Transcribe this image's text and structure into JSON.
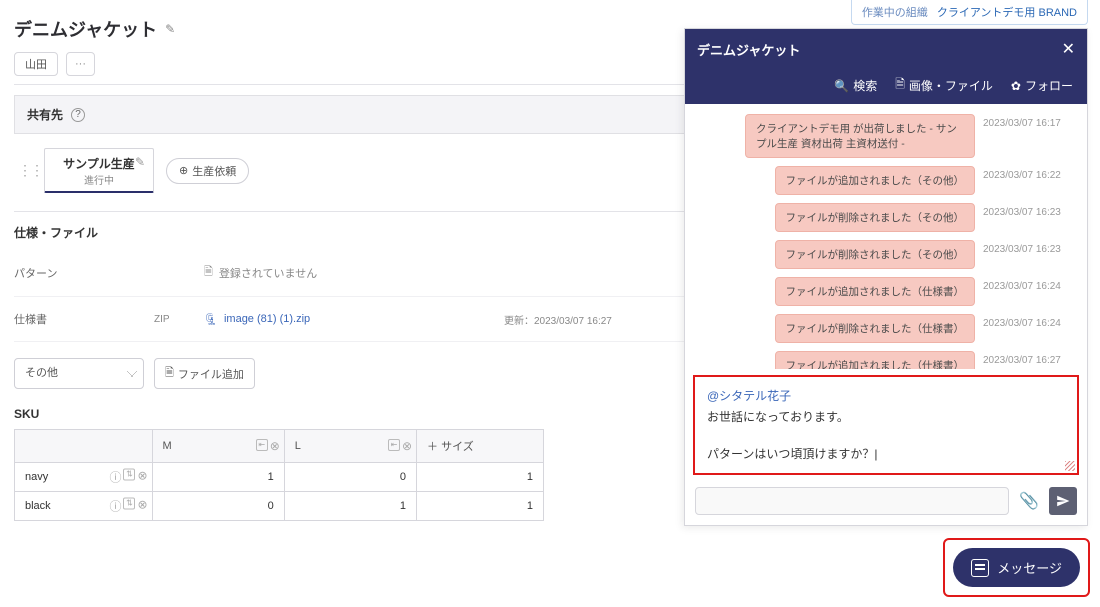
{
  "org_banner": {
    "label": "作業中の組織",
    "name": "クライアントデモ用 BRAND"
  },
  "page": {
    "title": "デニムジャケット",
    "chips": {
      "owner": "山田",
      "more": "···"
    },
    "share_label": "共有先",
    "tabs": {
      "sample": {
        "title": "サンプル生産",
        "sub": "進行中"
      },
      "production_btn": "生産依頼"
    },
    "spec_heading": "仕様・ファイル",
    "rows": {
      "pattern": {
        "label": "パターン",
        "placeholder": "登録されていません"
      },
      "spec": {
        "label": "仕様書",
        "ext": "ZIP",
        "filename": "image (81) (1).zip",
        "updated": "更新：2023/03/07 16:27"
      }
    },
    "controls": {
      "other_select": "その他",
      "file_add": "ファイル追加"
    },
    "sku_heading": "SKU",
    "sku": {
      "size_add": "＋ サイズ",
      "sizes": [
        "M",
        "L"
      ],
      "rows": [
        {
          "color": "navy",
          "values": [
            1,
            0,
            1
          ]
        },
        {
          "color": "black",
          "values": [
            0,
            1,
            1
          ]
        }
      ]
    }
  },
  "chat": {
    "title": "デニムジャケット",
    "actions": {
      "search": "検索",
      "images": "画像・ファイル",
      "follow": "フォロー"
    },
    "events": [
      {
        "text": "クライアントデモ用 が出荷しました\n- サンプル生産 資材出荷 主資材送付 -",
        "time": "2023/03/07 16:17"
      },
      {
        "text": "ファイルが追加されました（その他）",
        "time": "2023/03/07 16:22"
      },
      {
        "text": "ファイルが削除されました（その他）",
        "time": "2023/03/07 16:23"
      },
      {
        "text": "ファイルが削除されました（その他）",
        "time": "2023/03/07 16:23"
      },
      {
        "text": "ファイルが追加されました（仕様書）",
        "time": "2023/03/07 16:24"
      },
      {
        "text": "ファイルが削除されました（仕様書）",
        "time": "2023/03/07 16:24"
      },
      {
        "text": "ファイルが追加されました（仕様書）",
        "time": "2023/03/07 16:27"
      }
    ],
    "compose": {
      "mention": "@シタテル花子",
      "line1": "お世話になっております。",
      "line2": "パターンはいつ頃頂けますか？"
    }
  },
  "float_button": "メッセージ"
}
